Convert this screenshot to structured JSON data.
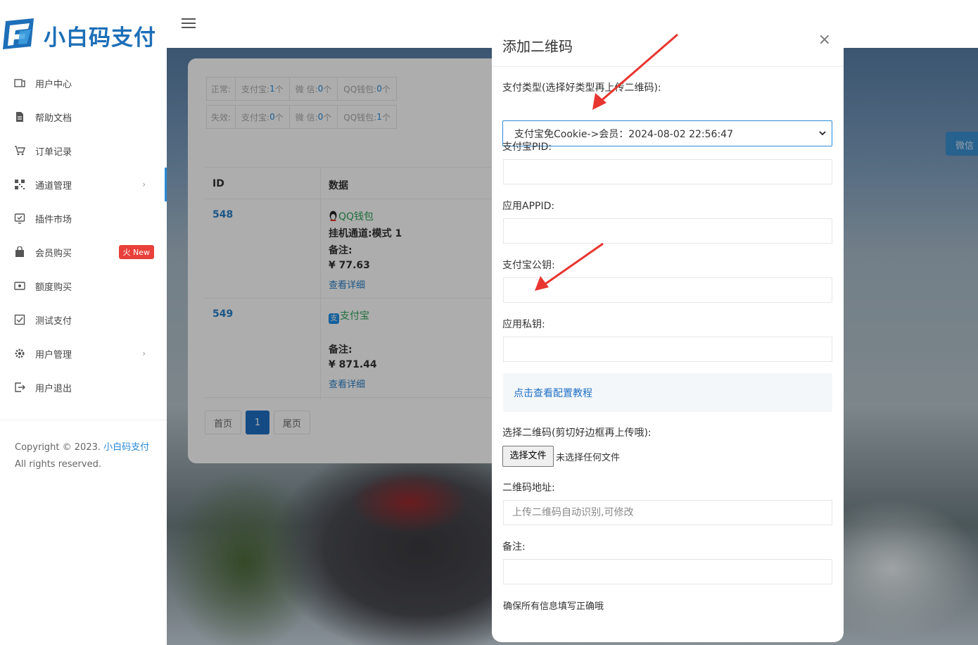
{
  "brand": {
    "name": "小白码支付"
  },
  "sidebar": {
    "items": [
      {
        "label": "用户中心",
        "icon": "dashboard-icon"
      },
      {
        "label": "帮助文档",
        "icon": "document-icon"
      },
      {
        "label": "订单记录",
        "icon": "cart-icon"
      },
      {
        "label": "通道管理",
        "icon": "qrcode-icon",
        "chevron": "›"
      },
      {
        "label": "插件市场",
        "icon": "plugin-icon"
      },
      {
        "label": "会员购买",
        "icon": "bag-icon",
        "badge": "火 New"
      },
      {
        "label": "额度购买",
        "icon": "card-icon"
      },
      {
        "label": "测试支付",
        "icon": "check-icon"
      },
      {
        "label": "用户管理",
        "icon": "gear-icon",
        "chevron": "›"
      },
      {
        "label": "用户退出",
        "icon": "logout-icon"
      }
    ],
    "copyright_prefix": "Copyright © 2023.",
    "copyright_link": "小白码支付",
    "rights": "All rights reserved."
  },
  "content": {
    "stats": {
      "normal_label": "正常:",
      "invalid_label": "失效:",
      "normal": [
        {
          "name": "支付宝:",
          "count": "1",
          "unit": "个"
        },
        {
          "name": "微 信:",
          "count": "0",
          "unit": "个"
        },
        {
          "name": "QQ钱包:",
          "count": "0",
          "unit": "个"
        }
      ],
      "invalid": [
        {
          "name": "支付宝:",
          "count": "0",
          "unit": "个"
        },
        {
          "name": "微 信:",
          "count": "0",
          "unit": "个"
        },
        {
          "name": "QQ钱包:",
          "count": "1",
          "unit": "个"
        }
      ]
    },
    "table": {
      "headers": [
        "ID",
        "数据"
      ],
      "rows": [
        {
          "id": "548",
          "type": "QQ钱包",
          "channel": "挂机通道:模式 1",
          "note_label": "备注:",
          "amount": "¥ 77.63",
          "detail": "查看详细"
        },
        {
          "id": "549",
          "type": "支付宝",
          "channel": "",
          "note_label": "备注:",
          "amount": "¥ 871.44",
          "detail": "查看详细"
        }
      ]
    },
    "pager": {
      "first": "首页",
      "current": "1",
      "last": "尾页"
    },
    "wechat_button": "微信"
  },
  "modal": {
    "title": "添加二维码",
    "close": "×",
    "pay_type_label": "支付类型(选择好类型再上传二维码):",
    "pay_type_value": "支付宝免Cookie->会员：2024-08-02 22:56:47",
    "alipay_pid_label": "支付宝PID:",
    "app_appid_label": "应用APPID:",
    "alipay_pubkey_label": "支付宝公钥:",
    "app_privkey_label": "应用私钥:",
    "tutorial_link": "点击查看配置教程",
    "qrcode_select_label": "选择二维码(剪切好边框再上传哦):",
    "file_button": "选择文件",
    "file_status": "未选择任何文件",
    "qrcode_url_label": "二维码地址:",
    "qrcode_url_placeholder": "上传二维码自动识别,可修改",
    "remark_label": "备注:",
    "final_note": "确保所有信息填写正确哦"
  },
  "colors": {
    "accent": "#2a8bd8",
    "brand": "#1d6fb8",
    "annotation_arrow": "#e8352f"
  }
}
